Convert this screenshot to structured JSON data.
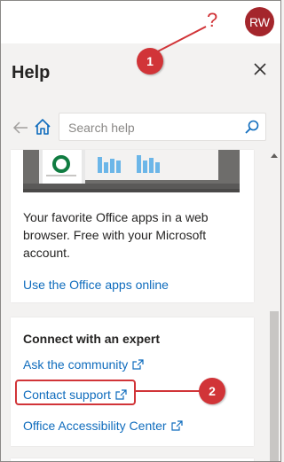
{
  "topbar": {
    "help_glyph": "?",
    "avatar_initials": "RW"
  },
  "pane": {
    "title": "Help"
  },
  "search": {
    "placeholder": "Search help"
  },
  "promo_card": {
    "text": "Your favorite Office apps in a web browser. Free with your Microsoft account.",
    "link": "Use the Office apps online"
  },
  "expert_card": {
    "heading": "Connect with an expert",
    "links": [
      "Ask the community",
      "Contact support",
      "Office Accessibility Center"
    ]
  },
  "annotations": {
    "callout_1": "1",
    "callout_2": "2"
  },
  "colors": {
    "accent": "#0f6cbd",
    "annotation": "#d13438",
    "avatar": "#a4262c"
  }
}
